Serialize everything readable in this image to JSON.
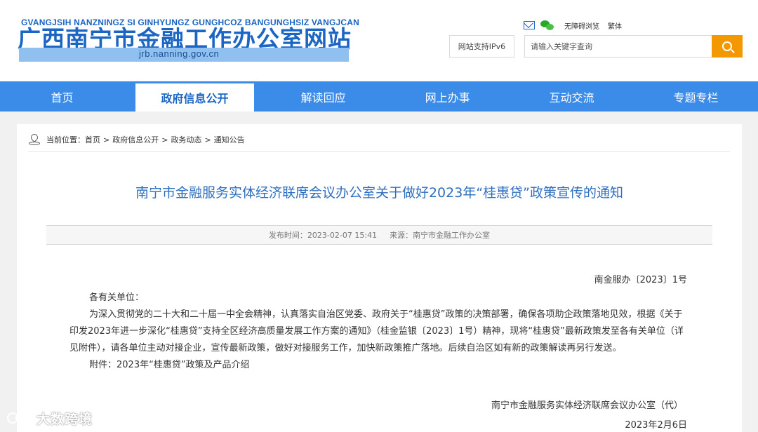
{
  "header": {
    "site_pinyin": "GVANGJSIH NANZNINGZ SI GINHYUNGZ GUNGHCOZ BANGUNGHSIZ VANGJCAN",
    "site_title": "广西南宁市金融工作办公室网站",
    "site_url": "jrb.nanning.gov.cn",
    "top_links": {
      "mail_icon": "mail-icon",
      "wechat_icon": "wechat-icon",
      "accessibility": "无障碍浏览",
      "traditional": "繁体"
    },
    "ipv6_label": "网站支持IPv6",
    "search_placeholder": "请输入关键字查询",
    "search_icon": "search-icon"
  },
  "nav": {
    "items": [
      {
        "label": "首页"
      },
      {
        "label": "政府信息公开",
        "active": true
      },
      {
        "label": "解读回应"
      },
      {
        "label": "网上办事"
      },
      {
        "label": "互动交流"
      },
      {
        "label": "专题专栏"
      }
    ]
  },
  "breadcrumb": {
    "prefix": "当前位置：",
    "items": [
      "首页",
      "政府信息公开",
      "政务动态",
      "通知公告"
    ],
    "separator": ">"
  },
  "article": {
    "title": "南宁市金融服务实体经济联席会议办公室关于做好2023年“桂惠贷”政策宣传的通知",
    "meta": {
      "published_label": "发布时间：",
      "published_value": "2023-02-07 15:41",
      "source_label": "来源：",
      "source_value": "南宁市金融工作办公室"
    },
    "doc_number": "南金服办〔2023〕1号",
    "salutation": "各有关单位：",
    "paragraph": "为深入贯彻党的二十大和二十届一中全会精神，认真落实自治区党委、政府关于“桂惠贷”政策的决策部署，确保各项助企政策落地见效，根据《关于印发2023年进一步深化“桂惠贷”支持全区经济高质量发展工作方案的通知》（桂金监银〔2023〕1号）精神，现将“桂惠贷”最新政策发至各有关单位（详见附件），请各单位主动对接企业，宣传最新政策，做好对接服务工作，加快新政策推广落地。后续自治区如有新的政策解读再另行发送。",
    "attachment": "附件：2023年“桂惠贷”政策及产品介绍",
    "signature": "南宁市金融服务实体经济联席会议办公室（代）",
    "date": "2023年2月6日"
  },
  "watermark": {
    "text": "大数跨境"
  },
  "colors": {
    "brand_blue": "#1b66c4",
    "nav_blue": "#3b8be8",
    "search_orange": "#f39800",
    "title_blue": "#2e6fbf"
  }
}
